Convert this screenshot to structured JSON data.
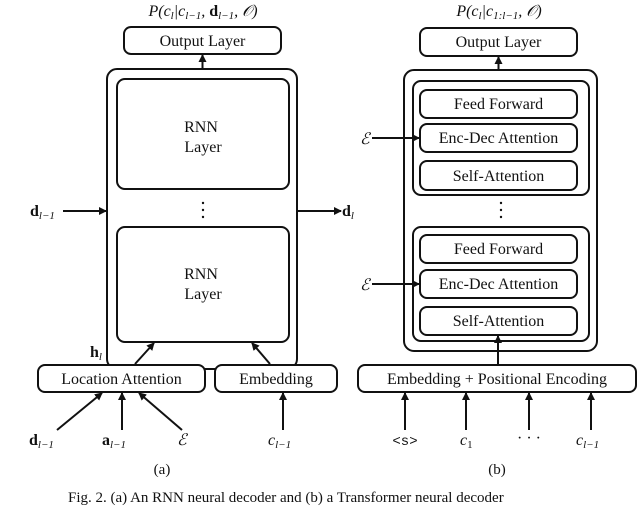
{
  "panel_a": {
    "formula": {
      "P": "P(",
      "c": "c",
      "c_sub": "l",
      "bar": "|c",
      "c_prev_sub": "l−1",
      "comma": ", ",
      "d": "d",
      "d_sub": "l−1",
      "tail": ", 𝒪)"
    },
    "output_layer": "Output Layer",
    "rnn_layer_top": [
      "RNN",
      "Layer"
    ],
    "rnn_layer_bottom": [
      "RNN",
      "Layer"
    ],
    "ellipsis": "⋮",
    "input_d": {
      "sym": "d",
      "sub": "l−1"
    },
    "output_d": {
      "sym": "d",
      "sub": "l"
    },
    "h_label": {
      "sym": "h",
      "sub": "l"
    },
    "location_attention": "Location Attention",
    "embedding": "Embedding",
    "inputs": [
      {
        "sym": "d",
        "sub": "l−1",
        "style": "bold"
      },
      {
        "sym": "a",
        "sub": "l−1",
        "style": "bold"
      },
      {
        "sym": "ℰ",
        "sub": "",
        "style": "math"
      },
      {
        "sym": "c",
        "sub": "l−1",
        "style": "math"
      }
    ],
    "caption": "(a)"
  },
  "panel_b": {
    "formula": {
      "P": "P(",
      "c": "c",
      "c_sub": "l",
      "bar": "|c",
      "c_prev_sub": "1:l−1",
      "tail": ", 𝒪)"
    },
    "output_layer": "Output Layer",
    "block_top": [
      "Feed Forward",
      "Enc-Dec Attention",
      "Self-Attention"
    ],
    "block_bottom": [
      "Feed Forward",
      "Enc-Dec Attention",
      "Self-Attention"
    ],
    "ellipsis": "⋮",
    "encoder_input": "ℰ",
    "embedding_pe": "Embedding + Positional Encoding",
    "inputs": [
      {
        "sym": "<s>",
        "sub": "",
        "style": "mono"
      },
      {
        "sym": "c",
        "sub": "1",
        "style": "math"
      },
      {
        "sym": "· · ·",
        "sub": "",
        "style": "plain"
      },
      {
        "sym": "c",
        "sub": "l−1",
        "style": "math"
      }
    ],
    "caption": "(b)"
  },
  "figure_caption": "Fig. 2.  (a) An RNN neural decoder and (b) a Transformer neural decoder"
}
